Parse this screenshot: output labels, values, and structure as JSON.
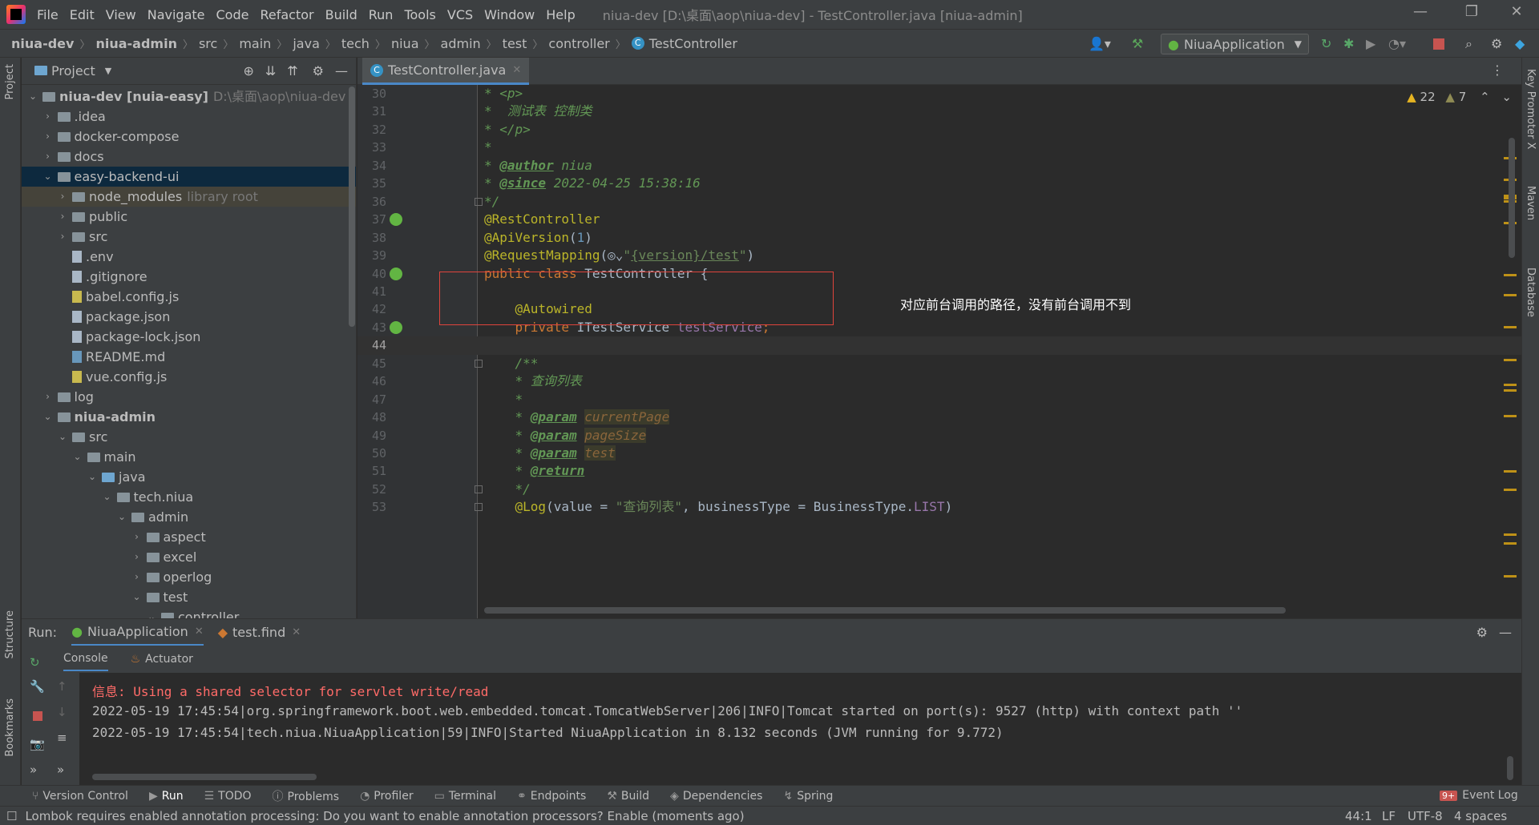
{
  "window": {
    "title": "niua-dev [D:\\桌面\\aop\\niua-dev] - TestController.java [niua-admin]"
  },
  "menu": [
    "File",
    "Edit",
    "View",
    "Navigate",
    "Code",
    "Refactor",
    "Build",
    "Run",
    "Tools",
    "VCS",
    "Window",
    "Help"
  ],
  "breadcrumb": [
    "niua-dev",
    "niua-admin",
    "src",
    "main",
    "java",
    "tech",
    "niua",
    "admin",
    "test",
    "controller",
    "TestController"
  ],
  "run_config": "NiuaApplication",
  "project": {
    "header": "Project",
    "tree": [
      {
        "label": "niua-dev [nuia-easy]",
        "extra": "D:\\桌面\\aop\\niua-dev",
        "depth": 0,
        "arrow": "open",
        "icon": "folder",
        "bold": true
      },
      {
        "label": ".idea",
        "depth": 1,
        "arrow": "closed",
        "icon": "folder"
      },
      {
        "label": "docker-compose",
        "depth": 1,
        "arrow": "closed",
        "icon": "folder"
      },
      {
        "label": "docs",
        "depth": 1,
        "arrow": "closed",
        "icon": "folder"
      },
      {
        "label": "easy-backend-ui",
        "depth": 1,
        "arrow": "open",
        "icon": "folder",
        "selected": true
      },
      {
        "label": "node_modules",
        "extra": "library root",
        "depth": 2,
        "arrow": "closed",
        "icon": "folder",
        "lib": true
      },
      {
        "label": "public",
        "depth": 2,
        "arrow": "closed",
        "icon": "folder"
      },
      {
        "label": "src",
        "depth": 2,
        "arrow": "closed",
        "icon": "folder"
      },
      {
        "label": ".env",
        "depth": 2,
        "arrow": "",
        "icon": "file"
      },
      {
        "label": ".gitignore",
        "depth": 2,
        "arrow": "",
        "icon": "file"
      },
      {
        "label": "babel.config.js",
        "depth": 2,
        "arrow": "",
        "icon": "js"
      },
      {
        "label": "package.json",
        "depth": 2,
        "arrow": "",
        "icon": "json"
      },
      {
        "label": "package-lock.json",
        "depth": 2,
        "arrow": "",
        "icon": "json"
      },
      {
        "label": "README.md",
        "depth": 2,
        "arrow": "",
        "icon": "md"
      },
      {
        "label": "vue.config.js",
        "depth": 2,
        "arrow": "",
        "icon": "js"
      },
      {
        "label": "log",
        "depth": 1,
        "arrow": "closed",
        "icon": "folder"
      },
      {
        "label": "niua-admin",
        "depth": 1,
        "arrow": "open",
        "icon": "folder",
        "bold": true
      },
      {
        "label": "src",
        "depth": 2,
        "arrow": "open",
        "icon": "folder"
      },
      {
        "label": "main",
        "depth": 3,
        "arrow": "open",
        "icon": "folder"
      },
      {
        "label": "java",
        "depth": 4,
        "arrow": "open",
        "icon": "blue"
      },
      {
        "label": "tech.niua",
        "depth": 5,
        "arrow": "open",
        "icon": "pkg"
      },
      {
        "label": "admin",
        "depth": 6,
        "arrow": "open",
        "icon": "pkg"
      },
      {
        "label": "aspect",
        "depth": 7,
        "arrow": "closed",
        "icon": "pkg"
      },
      {
        "label": "excel",
        "depth": 7,
        "arrow": "closed",
        "icon": "pkg"
      },
      {
        "label": "operlog",
        "depth": 7,
        "arrow": "closed",
        "icon": "pkg"
      },
      {
        "label": "test",
        "depth": 7,
        "arrow": "open",
        "icon": "pkg"
      },
      {
        "label": "controller",
        "depth": 8,
        "arrow": "open",
        "icon": "pkg"
      }
    ]
  },
  "editor": {
    "tab": "TestController.java",
    "warnings": "22",
    "weak_warnings": "7",
    "annotation_note": "对应前台调用的路径，没有前台调用不到",
    "lines": [
      {
        "n": "30",
        "parts": [
          [
            "c-doc",
            "* <p>"
          ]
        ]
      },
      {
        "n": "31",
        "parts": [
          [
            "c-doc",
            "*  测试表 控制类"
          ]
        ]
      },
      {
        "n": "32",
        "parts": [
          [
            "c-doc",
            "* </p>"
          ]
        ]
      },
      {
        "n": "33",
        "parts": [
          [
            "c-doc",
            "*"
          ]
        ]
      },
      {
        "n": "34",
        "parts": [
          [
            "c-doc",
            "* "
          ],
          [
            "c-tag",
            "@author"
          ],
          [
            "c-doc",
            " niua"
          ]
        ]
      },
      {
        "n": "35",
        "parts": [
          [
            "c-doc",
            "* "
          ],
          [
            "c-tag",
            "@since"
          ],
          [
            "c-doc",
            " 2022-04-25 15:38:16"
          ]
        ]
      },
      {
        "n": "36",
        "parts": [
          [
            "c-doc",
            "*/"
          ]
        ]
      },
      {
        "n": "37",
        "parts": [
          [
            "c-ann",
            "@RestController"
          ]
        ]
      },
      {
        "n": "38",
        "parts": [
          [
            "c-ann",
            "@ApiVersion"
          ],
          [
            "",
            "("
          ],
          [
            "c-num",
            "1"
          ],
          [
            "",
            ")"
          ]
        ]
      },
      {
        "n": "39",
        "parts": [
          [
            "c-ann",
            "@RequestMapping"
          ],
          [
            "",
            "(◎⌄"
          ],
          [
            "c-str",
            "\""
          ],
          [
            "c-path",
            "{version}/test"
          ],
          [
            "c-str",
            "\""
          ],
          [
            "",
            ")"
          ]
        ]
      },
      {
        "n": "40",
        "parts": [
          [
            "c-kw",
            "public class "
          ],
          [
            "",
            "TestController {"
          ]
        ]
      },
      {
        "n": "41",
        "parts": []
      },
      {
        "n": "42",
        "parts": [
          [
            "",
            "    "
          ],
          [
            "c-ann",
            "@Autowired"
          ]
        ]
      },
      {
        "n": "43",
        "parts": [
          [
            "",
            "    "
          ],
          [
            "c-kw",
            "private "
          ],
          [
            "",
            "ITestService "
          ],
          [
            "c-field",
            "testService"
          ],
          [
            "c-kw",
            ";"
          ]
        ]
      },
      {
        "n": "44",
        "parts": []
      },
      {
        "n": "45",
        "parts": [
          [
            "",
            "    "
          ],
          [
            "c-doc",
            "/**"
          ]
        ]
      },
      {
        "n": "46",
        "parts": [
          [
            "",
            "    "
          ],
          [
            "c-doc",
            "* 查询列表"
          ]
        ]
      },
      {
        "n": "47",
        "parts": [
          [
            "",
            "    "
          ],
          [
            "c-doc",
            "*"
          ]
        ]
      },
      {
        "n": "48",
        "parts": [
          [
            "",
            "    "
          ],
          [
            "c-doc",
            "* "
          ],
          [
            "c-tag",
            "@param"
          ],
          [
            "c-doc",
            " "
          ],
          [
            "c-pname",
            "currentPage"
          ]
        ]
      },
      {
        "n": "49",
        "parts": [
          [
            "",
            "    "
          ],
          [
            "c-doc",
            "* "
          ],
          [
            "c-tag",
            "@param"
          ],
          [
            "c-doc",
            " "
          ],
          [
            "c-pname",
            "pageSize"
          ]
        ]
      },
      {
        "n": "50",
        "parts": [
          [
            "",
            "    "
          ],
          [
            "c-doc",
            "* "
          ],
          [
            "c-tag",
            "@param"
          ],
          [
            "c-doc",
            " "
          ],
          [
            "c-pname",
            "test"
          ]
        ]
      },
      {
        "n": "51",
        "parts": [
          [
            "",
            "    "
          ],
          [
            "c-doc",
            "* "
          ],
          [
            "c-tag",
            "@return"
          ]
        ]
      },
      {
        "n": "52",
        "parts": [
          [
            "",
            "    "
          ],
          [
            "c-doc",
            "*/"
          ]
        ]
      },
      {
        "n": "53",
        "parts": [
          [
            "",
            "    "
          ],
          [
            "c-ann",
            "@Log"
          ],
          [
            "",
            "(value = "
          ],
          [
            "c-str",
            "\"查询列表\""
          ],
          [
            "",
            ", businessType = BusinessType."
          ],
          [
            "c-field",
            "LIST"
          ],
          [
            "",
            ")"
          ]
        ]
      }
    ]
  },
  "run": {
    "label": "Run:",
    "tabs": [
      "NiuaApplication",
      "test.find"
    ],
    "subtabs": [
      "Console",
      "Actuator"
    ],
    "console": [
      {
        "cls": "con-red",
        "text": "信息: Using a shared selector for servlet write/read"
      },
      {
        "cls": "con-normal",
        "text": "2022-05-19 17:45:54|org.springframework.boot.web.embedded.tomcat.TomcatWebServer|206|INFO|Tomcat started on port(s): 9527 (http) with context path ''"
      },
      {
        "cls": "con-normal",
        "text": "2022-05-19 17:45:54|tech.niua.NiuaApplication|59|INFO|Started NiuaApplication in 8.132 seconds (JVM running for 9.772)"
      }
    ]
  },
  "bottom_tabs": [
    "Version Control",
    "Run",
    "TODO",
    "Problems",
    "Profiler",
    "Terminal",
    "Endpoints",
    "Build",
    "Dependencies",
    "Spring"
  ],
  "event_log": {
    "badge": "9+",
    "label": "Event Log"
  },
  "status": {
    "message": "Lombok requires enabled annotation processing: Do you want to enable annotation processors? Enable (moments ago)",
    "position": "44:1",
    "line_sep": "LF",
    "encoding": "UTF-8",
    "indent": "4 spaces"
  },
  "side_labels": {
    "left": [
      "Project",
      "Structure",
      "Bookmarks"
    ],
    "right": [
      "Key Promoter X",
      "Maven",
      "Database"
    ]
  }
}
